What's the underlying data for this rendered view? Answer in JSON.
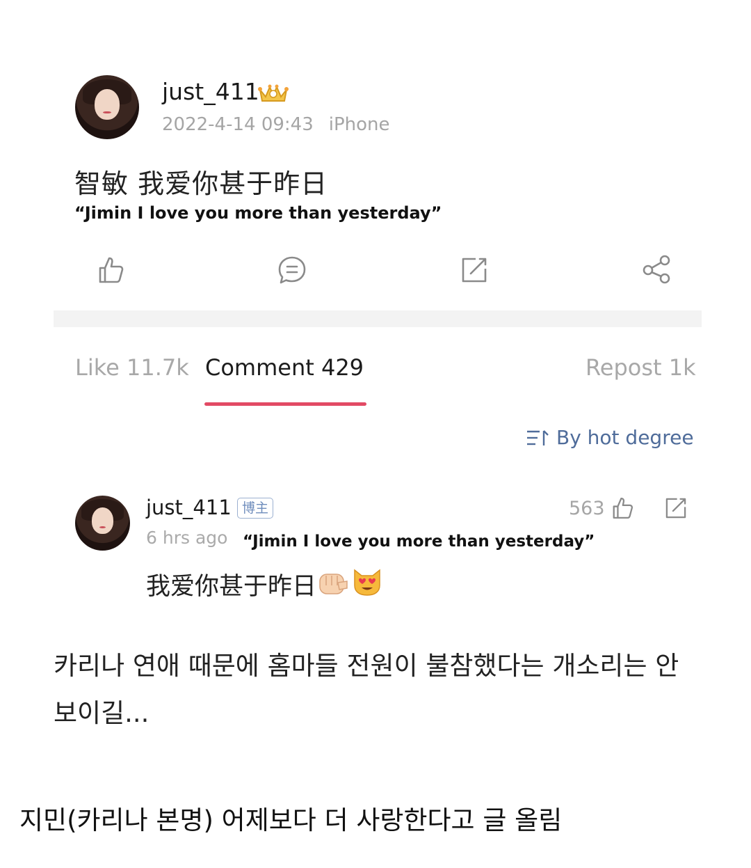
{
  "post": {
    "username": "just_411",
    "date": "2022-4-14 09:43",
    "device": "iPhone",
    "body": "智敏 我爱你甚于昨日",
    "caption": "“Jimin I love you more than yesterday”"
  },
  "actions": [
    "like-icon",
    "comment-icon",
    "repost-icon",
    "share-icon"
  ],
  "tabs": {
    "like": "Like 11.7k",
    "comment": "Comment 429",
    "repost": "Repost 1k",
    "active": "comment"
  },
  "sort": {
    "label": "By hot degree"
  },
  "comment": {
    "username": "just_411",
    "badge": "博主",
    "time": "6 hrs ago",
    "quote": "“Jimin I love you more than yesterday”",
    "body": "我爱你甚于昨日",
    "like_count": "563"
  },
  "korean_note": "카리나 연애 때문에 홈마들 전원이 불참했다는 개소리는 안 보이길...",
  "korean_title": "지민(카리나 본명) 어제보다 더 사랑한다고 글 올림",
  "colors": {
    "accent": "#e24a64",
    "link": "#4f6c9a",
    "muted": "#a5a5a5"
  }
}
